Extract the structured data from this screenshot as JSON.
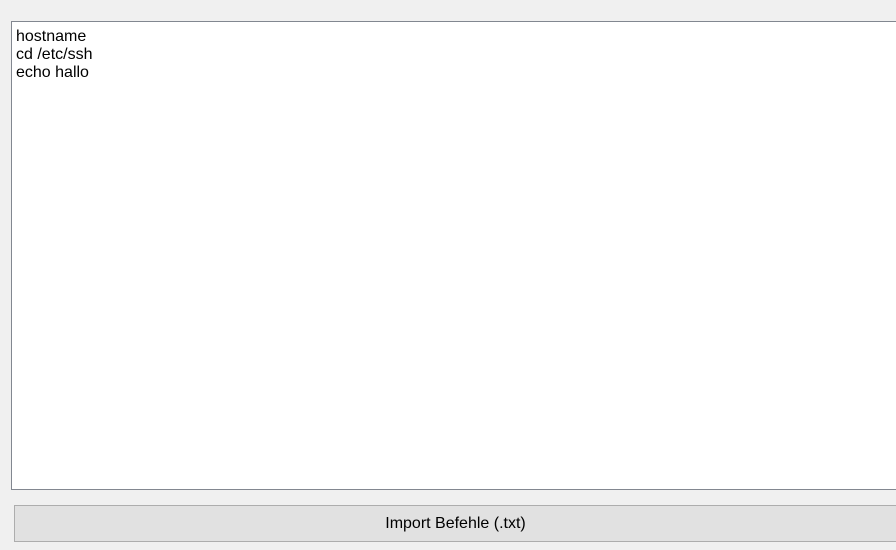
{
  "commands": {
    "lines": [
      "hostname",
      "cd /etc/ssh",
      "echo hallo"
    ]
  },
  "import_button": {
    "label": "Import Befehle (.txt)"
  },
  "colors": {
    "window_bg": "#f0f0f0",
    "textbox_bg": "#ffffff",
    "textbox_border": "#828790",
    "button_bg": "#e1e1e1",
    "button_border": "#adadad"
  }
}
